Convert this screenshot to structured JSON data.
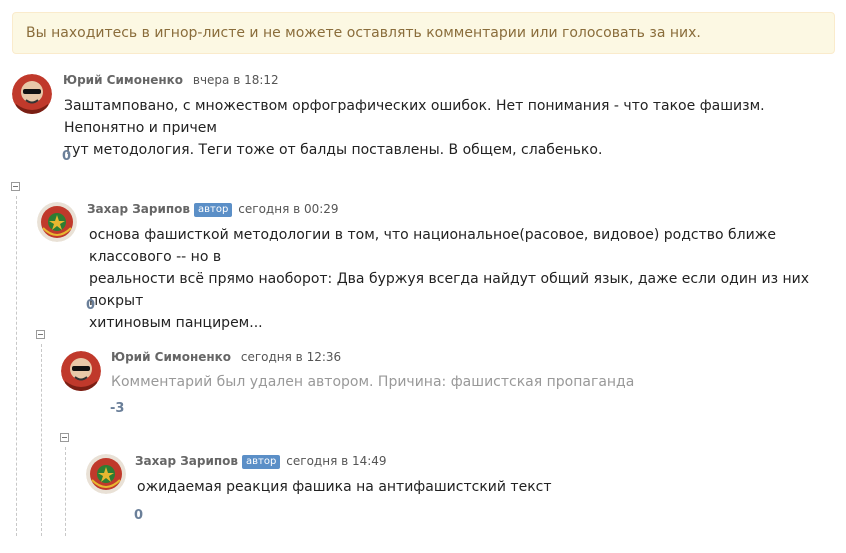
{
  "notice": "Вы находитесь в игнор-листе и не можете оставлять комментарии или голосовать за них.",
  "comments": [
    {
      "author": "Юрий Симоненко",
      "badge": "",
      "time": "вчера в 18:12",
      "text_lines": [
        "Заштамповано, с множеством орфографических ошибок. Нет понимания - что такое фашизм. Непонятно и причем",
        "тут методология. Теги тоже от балды поставлены. В общем, слабенько."
      ],
      "score": "0",
      "avatar": "skull-avatar"
    },
    {
      "author": "Захар Зарипов",
      "badge": "автор",
      "time": "сегодня в 00:29",
      "text_lines": [
        "основа фашисткой методологии в том, что национальное(расовое, видовое) родство ближе классового -- но в",
        "реальности всё прямо наоборот: Два буржуя всегда найдут общий язык, даже если один из них покрыт",
        "хитиновым панцирем..."
      ],
      "score": "0",
      "avatar": "emblem-avatar"
    },
    {
      "author": "Юрий Симоненко",
      "badge": "",
      "time": "сегодня в 12:36",
      "text_lines": [
        "Комментарий был удален автором. Причина: фашистская пропаганда"
      ],
      "score": "-3",
      "avatar": "skull-avatar"
    },
    {
      "author": "Захар Зарипов",
      "badge": "автор",
      "time": "сегодня в 14:49",
      "text_lines": [
        "ожидаемая реакция фашика на антифашистский текст"
      ],
      "score": "0",
      "avatar": "emblem-avatar"
    }
  ]
}
